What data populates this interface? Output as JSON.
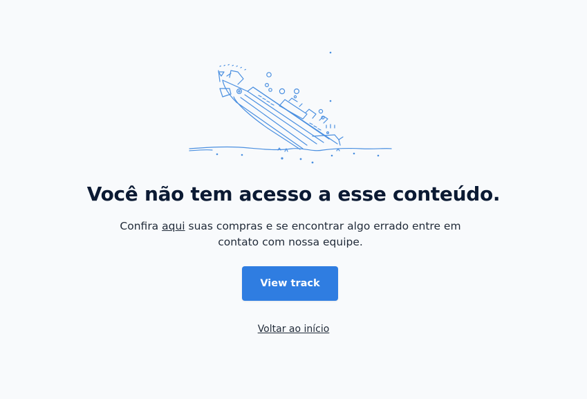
{
  "illustration": {
    "name": "sinking-ship-illustration",
    "stroke_color": "#4a8fe0"
  },
  "main": {
    "title": "Você não tem acesso a esse conteúdo.",
    "description_before": "Confira ",
    "description_link": "aqui",
    "description_after": " suas compras e se encontrar algo errado entre em contato com nossa equipe.",
    "primary_button_label": "View track",
    "back_link_label": "Voltar ao início"
  },
  "colors": {
    "background": "#f8fafc",
    "primary": "#2f7de1",
    "title": "#0b1a33"
  }
}
